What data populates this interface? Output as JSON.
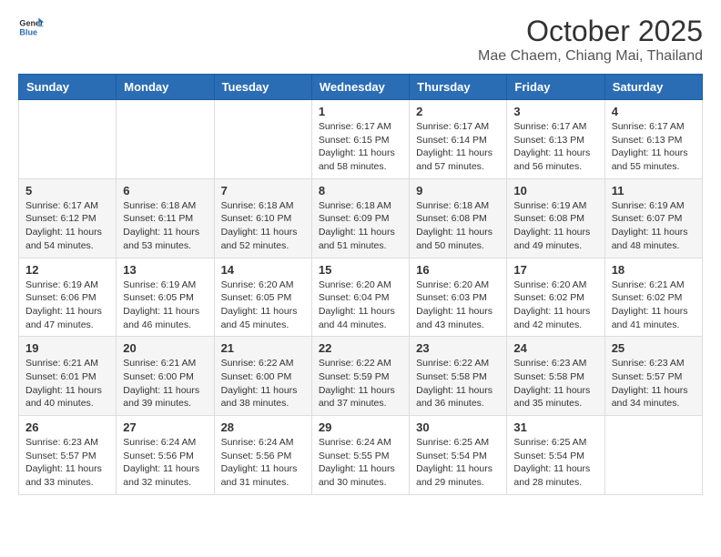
{
  "header": {
    "logo_general": "General",
    "logo_blue": "Blue",
    "month_title": "October 2025",
    "location": "Mae Chaem, Chiang Mai, Thailand"
  },
  "weekdays": [
    "Sunday",
    "Monday",
    "Tuesday",
    "Wednesday",
    "Thursday",
    "Friday",
    "Saturday"
  ],
  "weeks": [
    [
      {
        "day": "",
        "info": ""
      },
      {
        "day": "",
        "info": ""
      },
      {
        "day": "",
        "info": ""
      },
      {
        "day": "1",
        "info": "Sunrise: 6:17 AM\nSunset: 6:15 PM\nDaylight: 11 hours\nand 58 minutes."
      },
      {
        "day": "2",
        "info": "Sunrise: 6:17 AM\nSunset: 6:14 PM\nDaylight: 11 hours\nand 57 minutes."
      },
      {
        "day": "3",
        "info": "Sunrise: 6:17 AM\nSunset: 6:13 PM\nDaylight: 11 hours\nand 56 minutes."
      },
      {
        "day": "4",
        "info": "Sunrise: 6:17 AM\nSunset: 6:13 PM\nDaylight: 11 hours\nand 55 minutes."
      }
    ],
    [
      {
        "day": "5",
        "info": "Sunrise: 6:17 AM\nSunset: 6:12 PM\nDaylight: 11 hours\nand 54 minutes."
      },
      {
        "day": "6",
        "info": "Sunrise: 6:18 AM\nSunset: 6:11 PM\nDaylight: 11 hours\nand 53 minutes."
      },
      {
        "day": "7",
        "info": "Sunrise: 6:18 AM\nSunset: 6:10 PM\nDaylight: 11 hours\nand 52 minutes."
      },
      {
        "day": "8",
        "info": "Sunrise: 6:18 AM\nSunset: 6:09 PM\nDaylight: 11 hours\nand 51 minutes."
      },
      {
        "day": "9",
        "info": "Sunrise: 6:18 AM\nSunset: 6:08 PM\nDaylight: 11 hours\nand 50 minutes."
      },
      {
        "day": "10",
        "info": "Sunrise: 6:19 AM\nSunset: 6:08 PM\nDaylight: 11 hours\nand 49 minutes."
      },
      {
        "day": "11",
        "info": "Sunrise: 6:19 AM\nSunset: 6:07 PM\nDaylight: 11 hours\nand 48 minutes."
      }
    ],
    [
      {
        "day": "12",
        "info": "Sunrise: 6:19 AM\nSunset: 6:06 PM\nDaylight: 11 hours\nand 47 minutes."
      },
      {
        "day": "13",
        "info": "Sunrise: 6:19 AM\nSunset: 6:05 PM\nDaylight: 11 hours\nand 46 minutes."
      },
      {
        "day": "14",
        "info": "Sunrise: 6:20 AM\nSunset: 6:05 PM\nDaylight: 11 hours\nand 45 minutes."
      },
      {
        "day": "15",
        "info": "Sunrise: 6:20 AM\nSunset: 6:04 PM\nDaylight: 11 hours\nand 44 minutes."
      },
      {
        "day": "16",
        "info": "Sunrise: 6:20 AM\nSunset: 6:03 PM\nDaylight: 11 hours\nand 43 minutes."
      },
      {
        "day": "17",
        "info": "Sunrise: 6:20 AM\nSunset: 6:02 PM\nDaylight: 11 hours\nand 42 minutes."
      },
      {
        "day": "18",
        "info": "Sunrise: 6:21 AM\nSunset: 6:02 PM\nDaylight: 11 hours\nand 41 minutes."
      }
    ],
    [
      {
        "day": "19",
        "info": "Sunrise: 6:21 AM\nSunset: 6:01 PM\nDaylight: 11 hours\nand 40 minutes."
      },
      {
        "day": "20",
        "info": "Sunrise: 6:21 AM\nSunset: 6:00 PM\nDaylight: 11 hours\nand 39 minutes."
      },
      {
        "day": "21",
        "info": "Sunrise: 6:22 AM\nSunset: 6:00 PM\nDaylight: 11 hours\nand 38 minutes."
      },
      {
        "day": "22",
        "info": "Sunrise: 6:22 AM\nSunset: 5:59 PM\nDaylight: 11 hours\nand 37 minutes."
      },
      {
        "day": "23",
        "info": "Sunrise: 6:22 AM\nSunset: 5:58 PM\nDaylight: 11 hours\nand 36 minutes."
      },
      {
        "day": "24",
        "info": "Sunrise: 6:23 AM\nSunset: 5:58 PM\nDaylight: 11 hours\nand 35 minutes."
      },
      {
        "day": "25",
        "info": "Sunrise: 6:23 AM\nSunset: 5:57 PM\nDaylight: 11 hours\nand 34 minutes."
      }
    ],
    [
      {
        "day": "26",
        "info": "Sunrise: 6:23 AM\nSunset: 5:57 PM\nDaylight: 11 hours\nand 33 minutes."
      },
      {
        "day": "27",
        "info": "Sunrise: 6:24 AM\nSunset: 5:56 PM\nDaylight: 11 hours\nand 32 minutes."
      },
      {
        "day": "28",
        "info": "Sunrise: 6:24 AM\nSunset: 5:56 PM\nDaylight: 11 hours\nand 31 minutes."
      },
      {
        "day": "29",
        "info": "Sunrise: 6:24 AM\nSunset: 5:55 PM\nDaylight: 11 hours\nand 30 minutes."
      },
      {
        "day": "30",
        "info": "Sunrise: 6:25 AM\nSunset: 5:54 PM\nDaylight: 11 hours\nand 29 minutes."
      },
      {
        "day": "31",
        "info": "Sunrise: 6:25 AM\nSunset: 5:54 PM\nDaylight: 11 hours\nand 28 minutes."
      },
      {
        "day": "",
        "info": ""
      }
    ]
  ]
}
